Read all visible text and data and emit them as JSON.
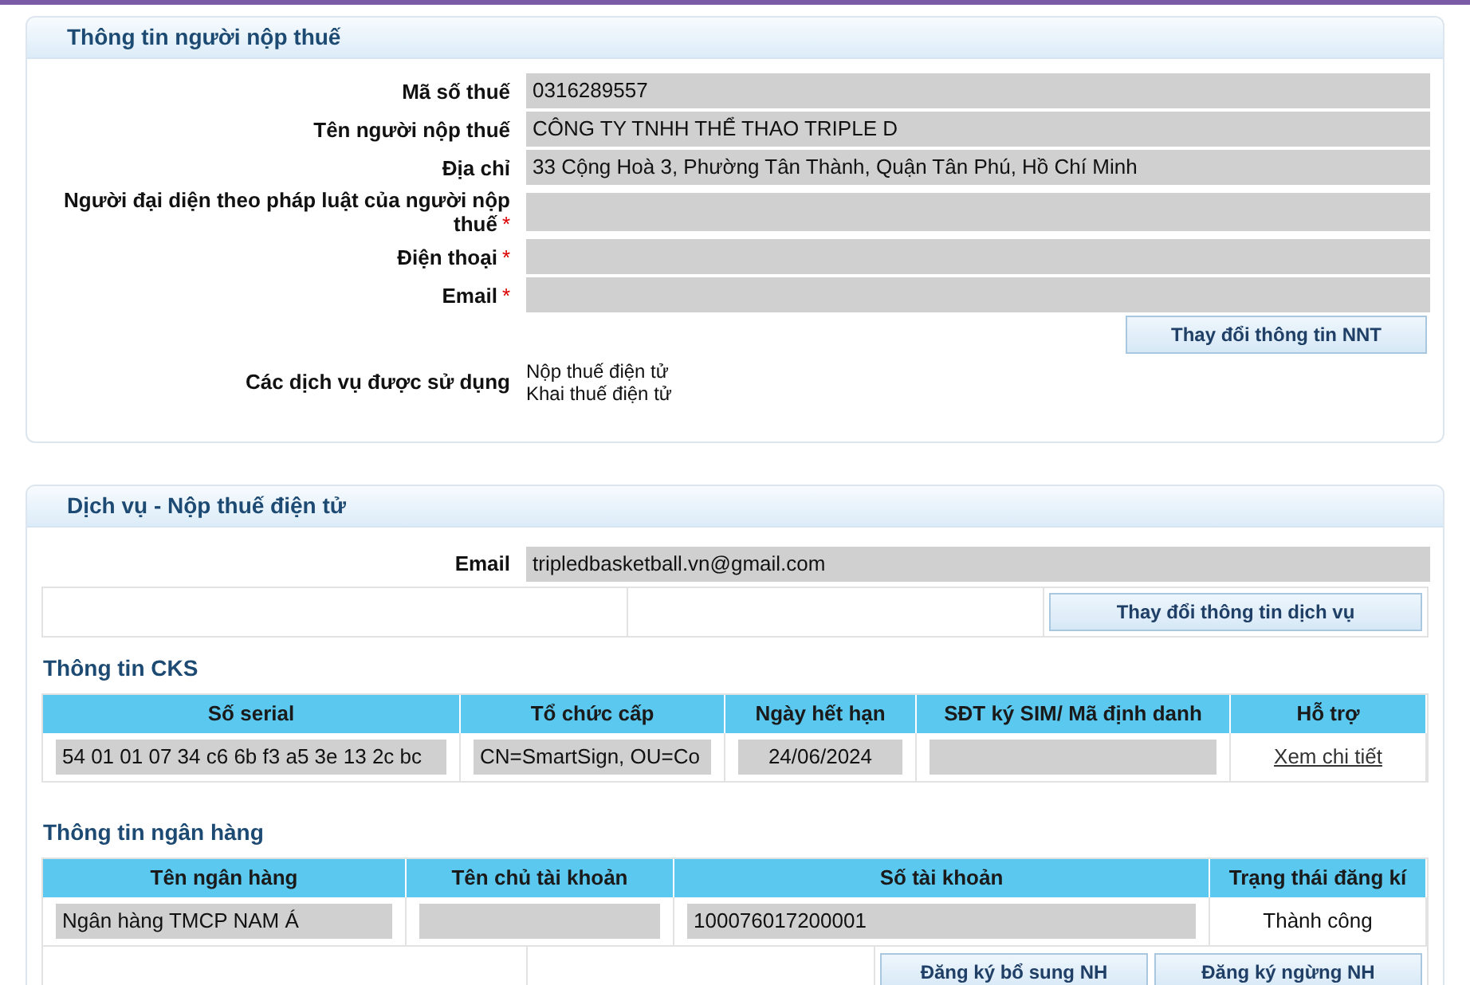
{
  "taxpayer_panel": {
    "title": "Thông tin người nộp thuế",
    "fields": [
      {
        "label": "Mã số thuế",
        "value": "0316289557"
      },
      {
        "label": "Tên người nộp thuế",
        "value": "CÔNG TY TNHH THỂ THAO TRIPLE D"
      },
      {
        "label": "Địa chỉ",
        "value": "33 Cộng Hoà 3, Phường Tân Thành, Quận Tân Phú, Hồ Chí Minh"
      },
      {
        "label": "Người đại diện theo pháp luật của người nộp thuế",
        "required_mark": "*"
      },
      {
        "label": "Điện thoại",
        "required_mark": "*"
      },
      {
        "label": "Email",
        "required_mark": "*"
      }
    ],
    "change_button": "Thay đổi thông tin NNT",
    "services_label": "Các dịch vụ được sử dụng",
    "services": [
      "Nộp thuế điện tử",
      "Khai thuế điện tử"
    ]
  },
  "service_panel": {
    "title": "Dịch vụ - Nộp thuế điện tử",
    "email_label": "Email",
    "email_value": "tripledbasketball.vn@gmail.com",
    "change_button": "Thay đổi thông tin dịch vụ",
    "cks": {
      "title": "Thông tin CKS",
      "columns": [
        "Số serial",
        "Tổ chức cấp",
        "Ngày hết hạn",
        "SĐT ký SIM/ Mã định danh",
        "Hỗ trợ"
      ],
      "rows": [
        {
          "cells": [
            {
              "kind": "field",
              "value": "54 01 01 07 34 c6 6b f3 a5 3e 13 2c bc"
            },
            {
              "kind": "field",
              "value": "CN=SmartSign, OU=Co"
            },
            {
              "kind": "field",
              "value": "24/06/2024"
            },
            {
              "kind": "field"
            },
            {
              "kind": "link",
              "value": "Xem chi tiết"
            }
          ]
        }
      ]
    },
    "bank": {
      "title": "Thông tin ngân hàng",
      "columns": [
        "Tên ngân hàng",
        "Tên chủ tài khoản",
        "Số tài khoản",
        "Trạng thái đăng kí"
      ],
      "rows": [
        {
          "cells": [
            {
              "kind": "field",
              "value": "Ngân hàng TMCP NAM Á"
            },
            {
              "kind": "field"
            },
            {
              "kind": "field",
              "value": "100076017200001"
            },
            {
              "kind": "text",
              "value": "Thành công"
            }
          ]
        }
      ],
      "buttons": [
        "Đăng ký bổ sung NH",
        "Đăng ký ngừng NH"
      ]
    }
  }
}
